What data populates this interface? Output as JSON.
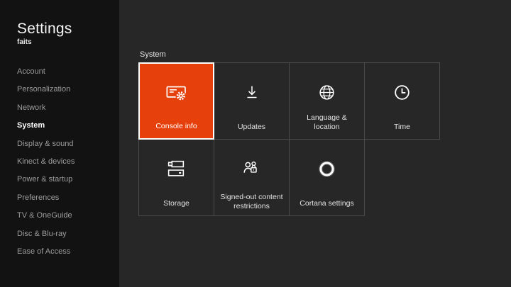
{
  "app": {
    "title": "Settings",
    "subtitle": "faits"
  },
  "sidebar": {
    "items": [
      {
        "label": "Account",
        "active": false
      },
      {
        "label": "Personalization",
        "active": false
      },
      {
        "label": "Network",
        "active": false
      },
      {
        "label": "System",
        "active": true
      },
      {
        "label": "Display & sound",
        "active": false
      },
      {
        "label": "Kinect & devices",
        "active": false
      },
      {
        "label": "Power & startup",
        "active": false
      },
      {
        "label": "Preferences",
        "active": false
      },
      {
        "label": "TV & OneGuide",
        "active": false
      },
      {
        "label": "Disc & Blu-ray",
        "active": false
      },
      {
        "label": "Ease of Access",
        "active": false
      }
    ]
  },
  "main": {
    "section_label": "System",
    "tiles": [
      {
        "label": "Console info",
        "icon": "console-gear-icon",
        "selected": true
      },
      {
        "label": "Updates",
        "icon": "download-icon",
        "selected": false
      },
      {
        "label": "Language & location",
        "icon": "globe-icon",
        "selected": false
      },
      {
        "label": "Time",
        "icon": "clock-icon",
        "selected": false
      },
      {
        "label": "Storage",
        "icon": "storage-drives-icon",
        "selected": false
      },
      {
        "label": "Signed-out content restrictions",
        "icon": "people-lock-icon",
        "selected": false
      },
      {
        "label": "Cortana settings",
        "icon": "cortana-ring-icon",
        "selected": false
      }
    ]
  },
  "colors": {
    "accent": "#E6400C",
    "focus_ring": "#ffffff",
    "tile_border": "#4b4b4b",
    "main_bg": "#272727",
    "sidebar_bg": "#121212",
    "inactive_text": "#9c9c9c",
    "active_text": "#ffffff"
  }
}
